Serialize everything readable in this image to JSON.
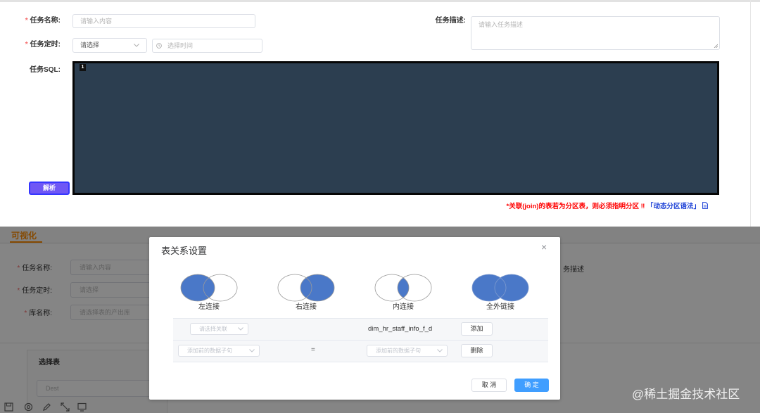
{
  "top_form": {
    "task_name": {
      "required_mark": "*",
      "label": "任务名称:",
      "placeholder": "请输入内容"
    },
    "task_timer": {
      "required_mark": "*",
      "label": "任务定时:",
      "select_value": "请选择",
      "time_placeholder": "选择时间"
    },
    "task_description": {
      "label": "任务描述:",
      "placeholder": "请输入任务描述"
    },
    "task_sql": {
      "label": "任务SQL:",
      "line_number": "1",
      "parse_button": "解析"
    },
    "notice": {
      "text": "*关联(join)的表若为分区表，则必须指明分区 ‼ ",
      "link": "「动态分区语法」",
      "icon": "document-icon"
    }
  },
  "background_page": {
    "tab": "可视化",
    "task_name": {
      "required_mark": "*",
      "label": "任务名称:",
      "placeholder": "请输入内容"
    },
    "task_timer": {
      "required_mark": "*",
      "label": "任务定时:",
      "placeholder": "请选择"
    },
    "database": {
      "required_mark": "*",
      "label": "库名称:",
      "placeholder": "请选择表的产出库"
    },
    "description_fragment": "务描述",
    "select_table_label": "选择表",
    "table_value": "Dest",
    "toolbar_icons": [
      "save-icon",
      "settings-icon",
      "edit-icon",
      "expand-icon",
      "monitor-icon"
    ]
  },
  "modal": {
    "title": "表关系设置",
    "close": "×",
    "join_types": [
      {
        "label": "左连接",
        "type": "left"
      },
      {
        "label": "右连接",
        "type": "right"
      },
      {
        "label": "内连接",
        "type": "inner"
      },
      {
        "label": "全外链接",
        "type": "full"
      }
    ],
    "relation_row": {
      "select_placeholder": "请选择关联",
      "table_name": "dim_hr_staff_info_f_d",
      "add_button": "添加"
    },
    "condition_row": {
      "left_placeholder": "添加前的数据子句",
      "operator": "=",
      "right_placeholder": "添加前的数据子句",
      "delete_button": "删除"
    },
    "cancel_button": "取 消",
    "confirm_button": "确 定"
  },
  "watermark": "@稀土掘金技术社区",
  "colors": {
    "required": "#f56c6c",
    "warning_text": "#ff0000",
    "link_text": "#1a3fd6",
    "editor_background": "#2c3e50",
    "parse_button": "#6f57f5",
    "tab_accent": "#ff8c00",
    "venn_fill": "#4a78c8",
    "primary_button": "#409eff"
  }
}
